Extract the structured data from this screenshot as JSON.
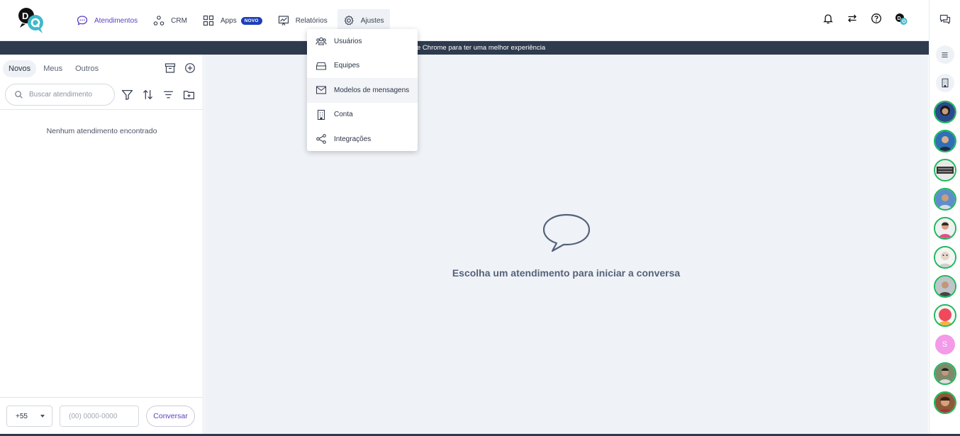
{
  "nav": {
    "items": [
      {
        "label": "Atendimentos",
        "icon": "chat-icon"
      },
      {
        "label": "CRM",
        "icon": "crm-icon"
      },
      {
        "label": "Apps",
        "icon": "grid-icon",
        "badge": "NOVO"
      },
      {
        "label": "Relatórios",
        "icon": "chart-icon"
      },
      {
        "label": "Ajustes",
        "icon": "gear-icon"
      }
    ]
  },
  "banner": {
    "text": "e Chrome para ter uma melhor experiência"
  },
  "settings_menu": {
    "items": [
      {
        "label": "Usuários",
        "icon": "users-icon"
      },
      {
        "label": "Equipes",
        "icon": "inbox-icon"
      },
      {
        "label": "Modelos de mensagens",
        "icon": "mail-icon"
      },
      {
        "label": "Conta",
        "icon": "building-icon"
      },
      {
        "label": "Integrações",
        "icon": "share-icon"
      }
    ]
  },
  "left": {
    "tabs": [
      "Novos",
      "Meus",
      "Outros"
    ],
    "search_placeholder": "Buscar atendimento",
    "empty_text": "Nenhum atendimento encontrado",
    "country_code": "+55",
    "phone_placeholder": "(00) 0000-0000",
    "conversar_label": "Conversar"
  },
  "main": {
    "message": "Escolha um atendimento para iniciar a conversa"
  },
  "rail": {
    "avatar_letter": "S"
  },
  "colors": {
    "accent": "#5b3fc4",
    "badge": "#1f3fb8",
    "banner": "#2e3a4e",
    "online": "#1fb85c"
  }
}
